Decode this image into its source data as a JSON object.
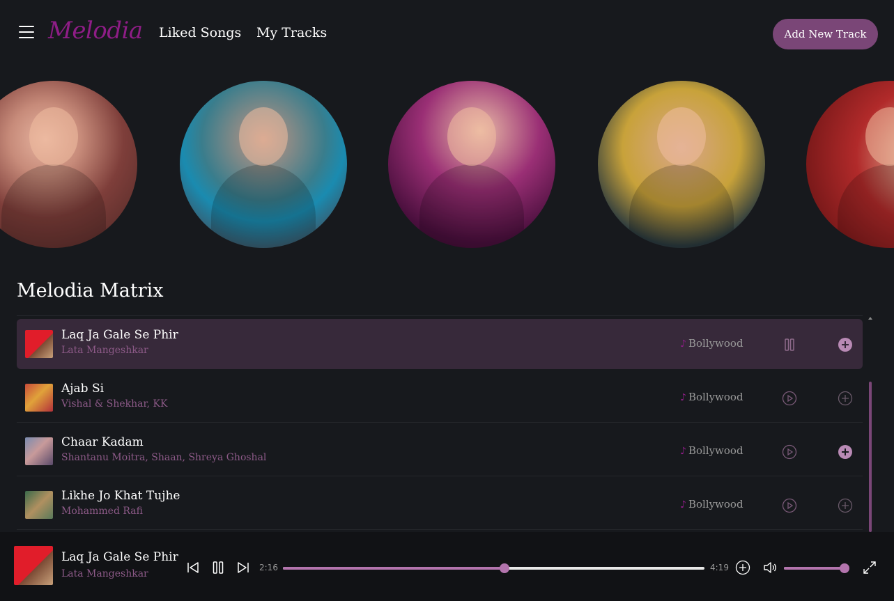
{
  "header": {
    "logo": "Melodia",
    "nav": [
      {
        "label": "Liked Songs"
      },
      {
        "label": "My Tracks"
      }
    ],
    "add_button": "Add New Track"
  },
  "artists_icons": [
    "artist-photo",
    "artist-photo",
    "artist-photo",
    "artist-photo",
    "artist-photo"
  ],
  "section_title": "Melodia Matrix",
  "tracks": [
    {
      "title": "Laq Ja Gale Se Phir",
      "artist": "Lata Mangeshkar",
      "genre": "Bollywood",
      "state": "playing",
      "added": true
    },
    {
      "title": "Ajab Si",
      "artist": "Vishal & Shekhar, KK",
      "genre": "Bollywood",
      "state": "paused",
      "added": false
    },
    {
      "title": "Chaar Kadam",
      "artist": "Shantanu Moitra, Shaan, Shreya Ghoshal",
      "genre": "Bollywood",
      "state": "paused",
      "added": true
    },
    {
      "title": "Likhe Jo Khat Tujhe",
      "artist": "Mohammed Rafi",
      "genre": "Bollywood",
      "state": "paused",
      "added": false
    }
  ],
  "player": {
    "title": "Laq Ja Gale Se Phir",
    "artist": "Lata Mangeshkar",
    "current_time": "2:16",
    "duration": "4:19",
    "progress": 0.525,
    "volume": 1.0
  },
  "colors": {
    "accent": "#8e1d86",
    "button": "#7a4677",
    "slider": "#b374ad",
    "artist_text": "#8d5a88",
    "active_row": "#37293a",
    "background": "#17191d"
  }
}
